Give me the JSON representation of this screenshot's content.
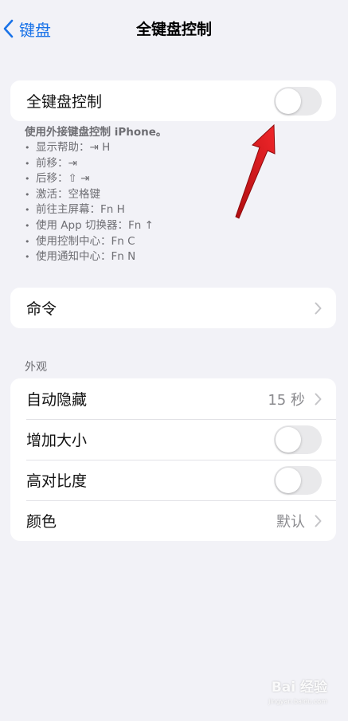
{
  "nav": {
    "back_label": "键盘",
    "title": "全键盘控制"
  },
  "main_toggle": {
    "label": "全键盘控制",
    "on": false
  },
  "footer": {
    "lead": "使用外接键盘控制 iPhone。",
    "items": [
      "显示帮助：⇥ H",
      "前移：⇥",
      "后移：⇧ ⇥",
      "激活：空格键",
      "前往主屏幕：Fn H",
      "使用 App 切换器：Fn ↑",
      "使用控制中心：Fn C",
      "使用通知中心：Fn N"
    ]
  },
  "commands": {
    "label": "命令"
  },
  "appearance": {
    "header": "外观",
    "auto_hide": {
      "label": "自动隐藏",
      "value": "15 秒"
    },
    "increase_size": {
      "label": "增加大小",
      "on": false
    },
    "high_contrast": {
      "label": "高对比度",
      "on": false
    },
    "color": {
      "label": "颜色",
      "value": "默认"
    }
  },
  "watermark": {
    "text": "Bai 经验",
    "sub": "jingyan.baidu.com"
  },
  "colors": {
    "accent": "#1a73e8",
    "background": "#f2f2f7",
    "annotation_arrow": "#e3161b"
  }
}
